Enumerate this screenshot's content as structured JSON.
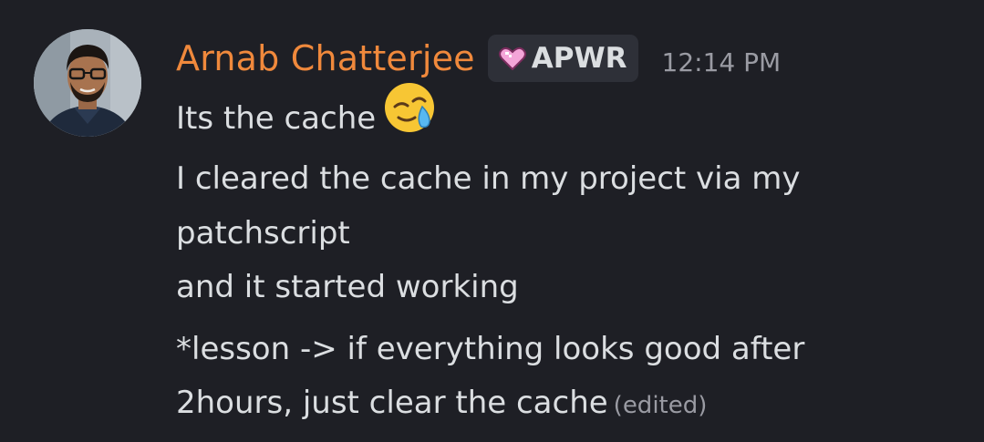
{
  "message": {
    "author": {
      "name": "Arnab Chatterjee",
      "name_color": "#f0893c",
      "avatar": "user-avatar-photo"
    },
    "tag": {
      "icon": "pink-heart-icon",
      "label": "APWR"
    },
    "timestamp": "12:14 PM",
    "lines": [
      {
        "text": "Its the cache",
        "emoji": "face-holding-back-tears-emoji"
      },
      {
        "text": "I cleared the cache in my project via my"
      },
      {
        "text": "patchscript"
      },
      {
        "text": "and it started working"
      },
      {
        "text": "*lesson -> if everything looks good after"
      },
      {
        "text": "2hours, just clear the cache"
      }
    ],
    "edited_label": "(edited)"
  },
  "colors": {
    "background": "#1e1f25",
    "text": "#dbdee1",
    "muted": "#9a9ba3",
    "tag_background": "#2e3038"
  }
}
